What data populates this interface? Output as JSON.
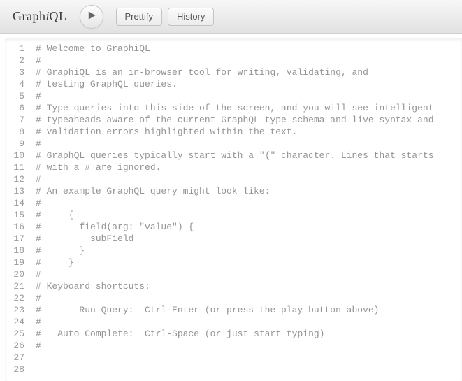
{
  "toolbar": {
    "title_prefix": "Graph",
    "title_em": "i",
    "title_suffix": "QL",
    "prettify_label": "Prettify",
    "history_label": "History"
  },
  "editor": {
    "lines": [
      "# Welcome to GraphiQL",
      "#",
      "# GraphiQL is an in-browser tool for writing, validating, and",
      "# testing GraphQL queries.",
      "#",
      "# Type queries into this side of the screen, and you will see intelligent",
      "# typeaheads aware of the current GraphQL type schema and live syntax and",
      "# validation errors highlighted within the text.",
      "#",
      "# GraphQL queries typically start with a \"{\" character. Lines that starts",
      "# with a # are ignored.",
      "#",
      "# An example GraphQL query might look like:",
      "#",
      "#     {",
      "#       field(arg: \"value\") {",
      "#         subField",
      "#       }",
      "#     }",
      "#",
      "# Keyboard shortcuts:",
      "#",
      "#       Run Query:  Ctrl-Enter (or press the play button above)",
      "#",
      "#   Auto Complete:  Ctrl-Space (or just start typing)",
      "#",
      "",
      ""
    ]
  }
}
